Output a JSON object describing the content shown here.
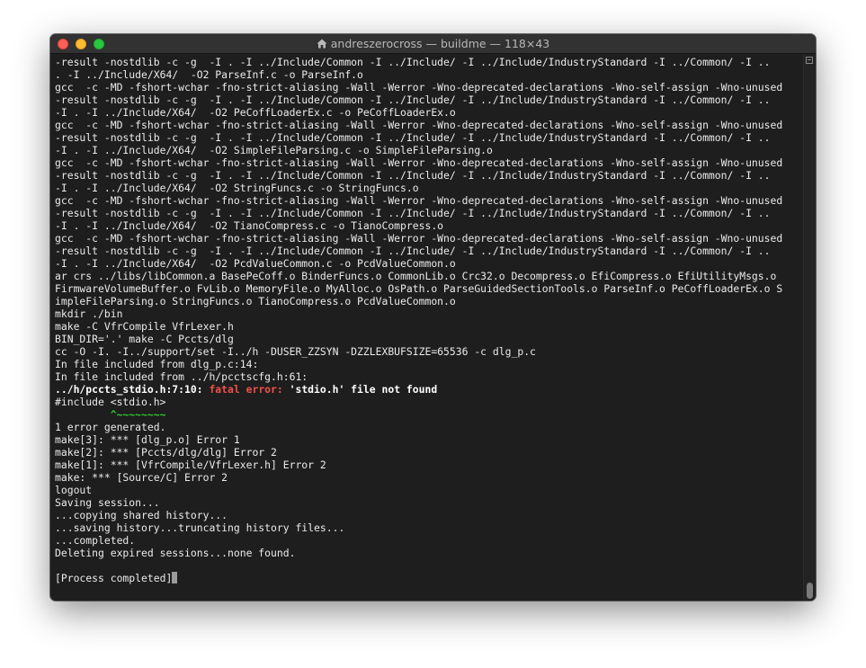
{
  "window": {
    "title": "andreszerocross — buildme — 118×43"
  },
  "terminal": {
    "lines": [
      "-result -nostdlib -c -g  -I . -I ../Include/Common -I ../Include/ -I ../Include/IndustryStandard -I ../Common/ -I ..",
      ". -I ../Include/X64/  -O2 ParseInf.c -o ParseInf.o",
      "gcc  -c -MD -fshort-wchar -fno-strict-aliasing -Wall -Werror -Wno-deprecated-declarations -Wno-self-assign -Wno-unused",
      "-result -nostdlib -c -g  -I . -I ../Include/Common -I ../Include/ -I ../Include/IndustryStandard -I ../Common/ -I ..",
      "-I . -I ../Include/X64/  -O2 PeCoffLoaderEx.c -o PeCoffLoaderEx.o",
      "gcc  -c -MD -fshort-wchar -fno-strict-aliasing -Wall -Werror -Wno-deprecated-declarations -Wno-self-assign -Wno-unused",
      "-result -nostdlib -c -g  -I . -I ../Include/Common -I ../Include/ -I ../Include/IndustryStandard -I ../Common/ -I ..",
      "-I . -I ../Include/X64/  -O2 SimpleFileParsing.c -o SimpleFileParsing.o",
      "gcc  -c -MD -fshort-wchar -fno-strict-aliasing -Wall -Werror -Wno-deprecated-declarations -Wno-self-assign -Wno-unused",
      "-result -nostdlib -c -g  -I . -I ../Include/Common -I ../Include/ -I ../Include/IndustryStandard -I ../Common/ -I ..",
      "-I . -I ../Include/X64/  -O2 StringFuncs.c -o StringFuncs.o",
      "gcc  -c -MD -fshort-wchar -fno-strict-aliasing -Wall -Werror -Wno-deprecated-declarations -Wno-self-assign -Wno-unused",
      "-result -nostdlib -c -g  -I . -I ../Include/Common -I ../Include/ -I ../Include/IndustryStandard -I ../Common/ -I ..",
      "-I . -I ../Include/X64/  -O2 TianoCompress.c -o TianoCompress.o",
      "gcc  -c -MD -fshort-wchar -fno-strict-aliasing -Wall -Werror -Wno-deprecated-declarations -Wno-self-assign -Wno-unused",
      "-result -nostdlib -c -g  -I . -I ../Include/Common -I ../Include/ -I ../Include/IndustryStandard -I ../Common/ -I ..",
      "-I . -I ../Include/X64/  -O2 PcdValueCommon.c -o PcdValueCommon.o",
      "ar crs ../libs/libCommon.a BasePeCoff.o BinderFuncs.o CommonLib.o Crc32.o Decompress.o EfiCompress.o EfiUtilityMsgs.o",
      "FirmwareVolumeBuffer.o FvLib.o MemoryFile.o MyAlloc.o OsPath.o ParseGuidedSectionTools.o ParseInf.o PeCoffLoaderEx.o S",
      "impleFileParsing.o StringFuncs.o TianoCompress.o PcdValueCommon.o",
      "mkdir ./bin",
      "make -C VfrCompile VfrLexer.h",
      "BIN_DIR='.' make -C Pccts/dlg",
      "cc -O -I. -I../support/set -I../h -DUSER_ZZSYN -DZZLEXBUFSIZE=65536 -c dlg_p.c",
      "In file included from dlg_p.c:14:",
      "In file included from ../h/pcctscfg.h:61:"
    ],
    "error_location": "../h/pccts_stdio.h:7:10: ",
    "error_label": "fatal error: ",
    "error_message": "'stdio.h' file not found",
    "include_line": "#include <stdio.h>",
    "caret_line": "         ^~~~~~~~~",
    "tail_lines": [
      "1 error generated.",
      "make[3]: *** [dlg_p.o] Error 1",
      "make[2]: *** [Pccts/dlg/dlg] Error 2",
      "make[1]: *** [VfrCompile/VfrLexer.h] Error 2",
      "make: *** [Source/C] Error 2",
      "logout",
      "Saving session...",
      "...copying shared history...",
      "...saving history...truncating history files...",
      "...completed.",
      "Deleting expired sessions...none found.",
      ""
    ],
    "process_completed": "[Process completed]"
  },
  "colors": {
    "background": "#1e1e1e",
    "text": "#ebebeb",
    "error": "#f25048",
    "caret": "#2ec82e"
  }
}
